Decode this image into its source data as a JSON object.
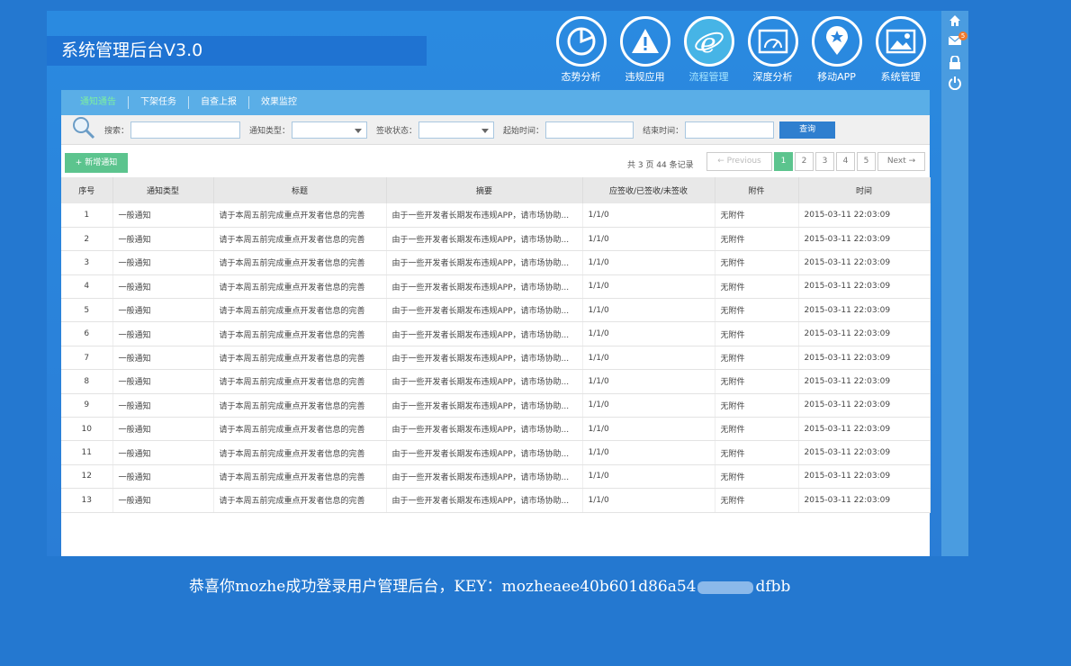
{
  "app": {
    "title": "系统管理后台V3.0"
  },
  "nav": [
    {
      "label": "态势分析",
      "icon": "pie-chart-icon"
    },
    {
      "label": "违规应用",
      "icon": "warning-icon"
    },
    {
      "label": "流程管理",
      "icon": "ie-browser-icon",
      "active": true
    },
    {
      "label": "深度分析",
      "icon": "gauge-icon"
    },
    {
      "label": "移动APP",
      "icon": "location-star-icon"
    },
    {
      "label": "系统管理",
      "icon": "image-settings-icon"
    }
  ],
  "sidebar": {
    "badge": "5"
  },
  "tabs": [
    "通知通告",
    "下架任务",
    "自查上报",
    "效果监控"
  ],
  "search": {
    "keyword_label": "搜索：",
    "type_label": "通知类型：",
    "status_label": "签收状态：",
    "start_label": "起始时间：",
    "end_label": "结束时间：",
    "query_button": "查询"
  },
  "toolbar": {
    "add_button": "+ 新增通知",
    "records": "共 3 页 44 条记录",
    "prev": "← Previous",
    "pages": [
      "1",
      "2",
      "3",
      "4",
      "5"
    ],
    "next": "Next →"
  },
  "table": {
    "headers": [
      "序号",
      "通知类型",
      "标题",
      "摘要",
      "应签收/已签收/未签收",
      "附件",
      "时间"
    ],
    "rows": [
      [
        "1",
        "一般通知",
        "请于本周五前完成重点开发者信息的完善",
        "由于一些开发者长期发布违规APP，请市场协助...",
        "1/1/0",
        "无附件",
        "2015-03-11 22:03:09"
      ],
      [
        "2",
        "一般通知",
        "请于本周五前完成重点开发者信息的完善",
        "由于一些开发者长期发布违规APP，请市场协助...",
        "1/1/0",
        "无附件",
        "2015-03-11 22:03:09"
      ],
      [
        "3",
        "一般通知",
        "请于本周五前完成重点开发者信息的完善",
        "由于一些开发者长期发布违规APP，请市场协助...",
        "1/1/0",
        "无附件",
        "2015-03-11 22:03:09"
      ],
      [
        "4",
        "一般通知",
        "请于本周五前完成重点开发者信息的完善",
        "由于一些开发者长期发布违规APP，请市场协助...",
        "1/1/0",
        "无附件",
        "2015-03-11 22:03:09"
      ],
      [
        "5",
        "一般通知",
        "请于本周五前完成重点开发者信息的完善",
        "由于一些开发者长期发布违规APP，请市场协助...",
        "1/1/0",
        "无附件",
        "2015-03-11 22:03:09"
      ],
      [
        "6",
        "一般通知",
        "请于本周五前完成重点开发者信息的完善",
        "由于一些开发者长期发布违规APP，请市场协助...",
        "1/1/0",
        "无附件",
        "2015-03-11 22:03:09"
      ],
      [
        "7",
        "一般通知",
        "请于本周五前完成重点开发者信息的完善",
        "由于一些开发者长期发布违规APP，请市场协助...",
        "1/1/0",
        "无附件",
        "2015-03-11 22:03:09"
      ],
      [
        "8",
        "一般通知",
        "请于本周五前完成重点开发者信息的完善",
        "由于一些开发者长期发布违规APP，请市场协助...",
        "1/1/0",
        "无附件",
        "2015-03-11 22:03:09"
      ],
      [
        "9",
        "一般通知",
        "请于本周五前完成重点开发者信息的完善",
        "由于一些开发者长期发布违规APP，请市场协助...",
        "1/1/0",
        "无附件",
        "2015-03-11 22:03:09"
      ],
      [
        "10",
        "一般通知",
        "请于本周五前完成重点开发者信息的完善",
        "由于一些开发者长期发布违规APP，请市场协助...",
        "1/1/0",
        "无附件",
        "2015-03-11 22:03:09"
      ],
      [
        "11",
        "一般通知",
        "请于本周五前完成重点开发者信息的完善",
        "由于一些开发者长期发布违规APP，请市场协助...",
        "1/1/0",
        "无附件",
        "2015-03-11 22:03:09"
      ],
      [
        "12",
        "一般通知",
        "请于本周五前完成重点开发者信息的完善",
        "由于一些开发者长期发布违规APP，请市场协助...",
        "1/1/0",
        "无附件",
        "2015-03-11 22:03:09"
      ],
      [
        "13",
        "一般通知",
        "请于本周五前完成重点开发者信息的完善",
        "由于一些开发者长期发布违规APP，请市场协助...",
        "1/1/0",
        "无附件",
        "2015-03-11 22:03:09"
      ]
    ]
  },
  "footer": {
    "message_prefix": "恭喜你mozhe成功登录用户管理后台，KEY：mozheaee40b601d86a54",
    "message_suffix": "dfbb"
  }
}
